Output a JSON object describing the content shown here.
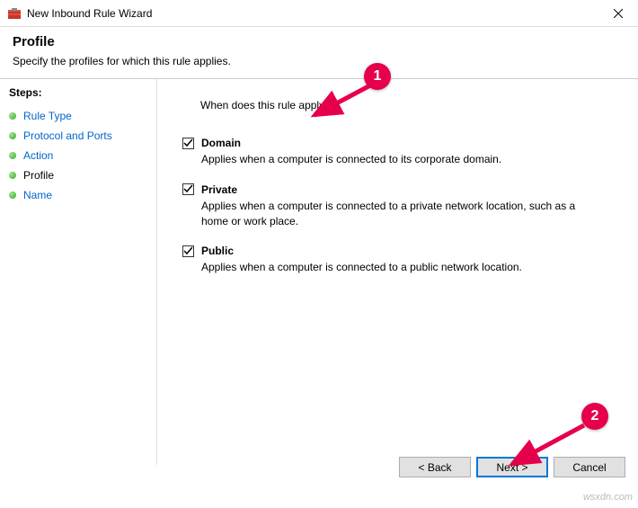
{
  "window": {
    "title": "New Inbound Rule Wizard"
  },
  "header": {
    "title": "Profile",
    "subtitle": "Specify the profiles for which this rule applies."
  },
  "sidebar": {
    "heading": "Steps:",
    "items": [
      {
        "label": "Rule Type",
        "current": false
      },
      {
        "label": "Protocol and Ports",
        "current": false
      },
      {
        "label": "Action",
        "current": false
      },
      {
        "label": "Profile",
        "current": true
      },
      {
        "label": "Name",
        "current": false
      }
    ]
  },
  "content": {
    "question": "When does this rule apply?",
    "options": [
      {
        "label": "Domain",
        "checked": true,
        "desc": "Applies when a computer is connected to its corporate domain."
      },
      {
        "label": "Private",
        "checked": true,
        "desc": "Applies when a computer is connected to a private network location, such as a home or work place."
      },
      {
        "label": "Public",
        "checked": true,
        "desc": "Applies when a computer is connected to a public network location."
      }
    ]
  },
  "footer": {
    "back": "< Back",
    "next": "Next >",
    "cancel": "Cancel"
  },
  "annotations": {
    "badge1": "1",
    "badge2": "2"
  },
  "watermark": "wsxdn.com"
}
